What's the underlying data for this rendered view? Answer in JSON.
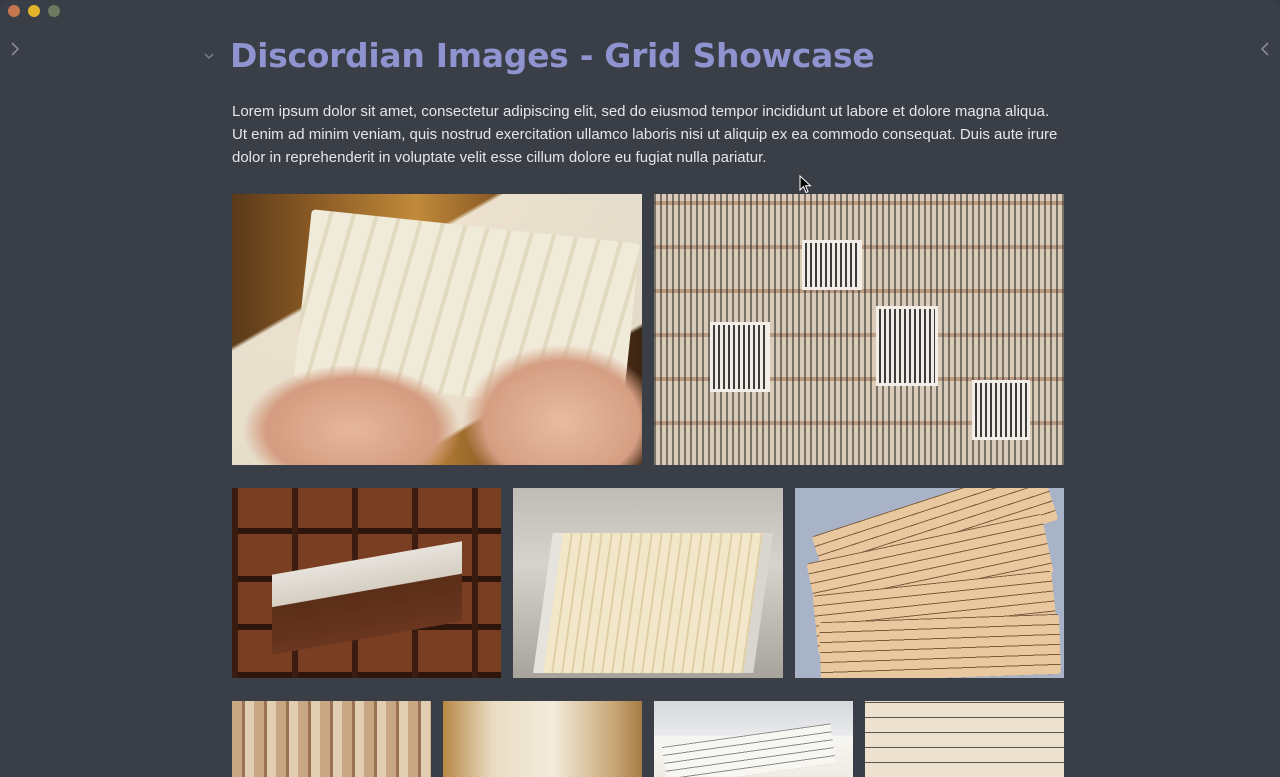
{
  "window": {
    "controls": [
      "close",
      "minimize",
      "zoom"
    ]
  },
  "sidebar": {
    "left_toggle_icon": "chevron-right-icon",
    "right_toggle_icon": "chevron-left-icon"
  },
  "document": {
    "title": "Discordian Images - Grid Showcase",
    "intro": "Lorem ipsum dolor sit amet, consectetur adipiscing elit, sed do eiusmod tempor incididunt ut labore et dolore magna aliqua. Ut enim ad minim veniam, quis nostrud exercitation ullamco laboris nisi ut aliquip ex ea commodo consequat. Duis aute irure dolor in reprehenderit in voluptate velit esse cillum dolore eu fugiat nulla pariatur."
  },
  "gallery": {
    "rows": [
      {
        "images": [
          "hands-holding-index-cards",
          "wall-of-paper-notes"
        ]
      },
      {
        "images": [
          "wooden-card-catalog-drawer",
          "metal-file-drawer-cards",
          "handwritten-yellowed-cards"
        ]
      },
      {
        "images": [
          "stacked-card-files",
          "card-box-closeup",
          "paper-notes-on-desk",
          "handwritten-card-closeup"
        ]
      }
    ]
  }
}
